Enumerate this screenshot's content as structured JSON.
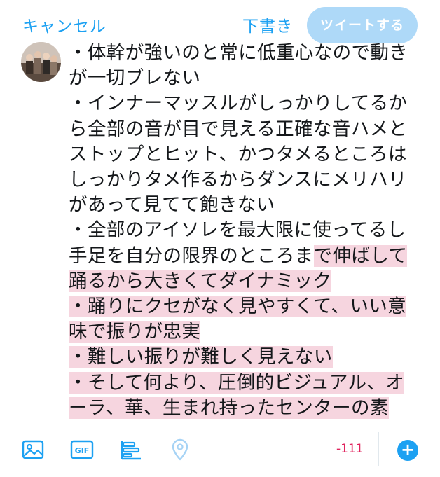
{
  "header": {
    "cancel_label": "キャンセル",
    "drafts_label": "下書き",
    "tweet_label": "ツイートする"
  },
  "compose": {
    "text_within_limit": "・体幹が強いのと常に低重心なので動きが一切ブレない\n・インナーマッスルがしっかりしてるから全部の音が目で見える正確な音ハメとストップとヒット、かつタメるところはしっかりタメ作るからダンスにメリハリがあって見てて飽きない\n・全部のアイソレを最大限に使ってるし手足を自分の限界のところま",
    "text_over_limit": "で伸ばして踊るから大きくてダイナミック\n・踊りにクセがなく見やすくて、いい意味で振りが忠実\n・難しい振りが難しく見えない\n・そして何より、圧倒的ビジュアル、オーラ、華、生まれ持ったセンターの素質、天性の才能、すごすぎて怖い。"
  },
  "toolbar": {
    "counter": "-111",
    "icons": [
      "image-icon",
      "gif-icon",
      "poll-icon",
      "location-icon",
      "add-tweet-icon"
    ]
  },
  "colors": {
    "accent": "#1da1f2",
    "tweet_button_disabled": "#aed9f8",
    "overflow_highlight": "#f6d5df",
    "counter_over": "#e0245e"
  }
}
